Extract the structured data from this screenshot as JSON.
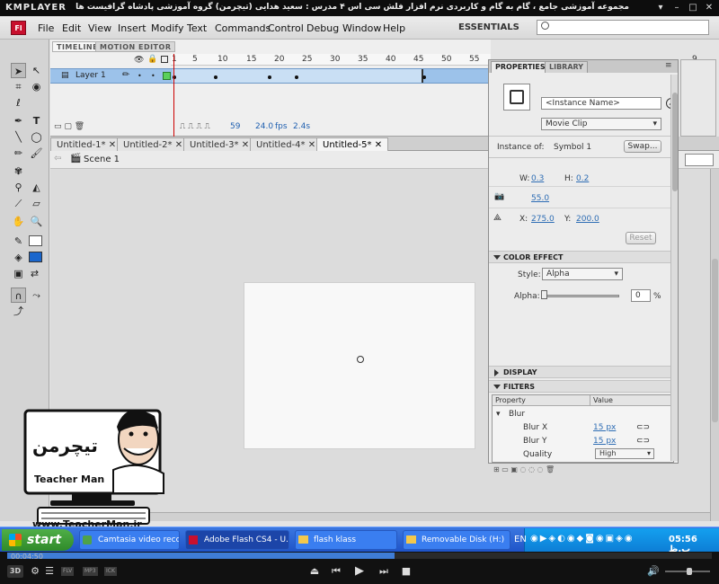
{
  "kmplayer": {
    "logo": "KMPLAYER",
    "title": "مجموعه آموزشی جامع ، گام به گام و کاربردی نرم افزار فلش سی اس ۴ مدرس : سعید هدایی (تیچرمن) گروه آموزشی پادشاه گرافیست ها",
    "time_display": "00:04:50",
    "progress": 0.55,
    "tags": [
      "FLV",
      "MP3",
      "ICK"
    ],
    "btn_3d": "3D"
  },
  "flash": {
    "logo": "Fl",
    "menu": [
      "File",
      "Edit",
      "View",
      "Insert",
      "Modify",
      "Text",
      "Commands",
      "Control",
      "Debug",
      "Window",
      "Help"
    ],
    "workspace": "ESSENTIALS",
    "search_placeholder": ""
  },
  "timeline": {
    "tabs": [
      "TIMELINE",
      "MOTION EDITOR"
    ],
    "frame_numbers": [
      "1",
      "5",
      "10",
      "15",
      "20",
      "25",
      "30",
      "35",
      "40",
      "45",
      "50",
      "55",
      "9"
    ],
    "layer_name": "Layer 1",
    "status": {
      "current_frame": "59",
      "fps": "24.0",
      "fps_unit": "fps",
      "time": "2.4s"
    }
  },
  "document_tabs": [
    "Untitled-1*",
    "Untitled-2*",
    "Untitled-3*",
    "Untitled-4*",
    "Untitled-5*"
  ],
  "scene": "Scene 1",
  "properties": {
    "tabs": [
      "PROPERTIES",
      "LIBRARY"
    ],
    "instance_name_placeholder": "<Instance Name>",
    "symbol_type": "Movie Clip",
    "instance_of_label": "Instance of:",
    "instance_of_value": "Symbol 1",
    "swap_label": "Swap...",
    "w_label": "W:",
    "w_value": "0.3",
    "h_label": "H:",
    "h_value": "0.2",
    "cam_value": "55.0",
    "x_label": "X:",
    "x_value": "275.0",
    "y_label": "Y:",
    "y_value": "200.0",
    "reset_label": "Reset",
    "color_effect_header": "COLOR EFFECT",
    "style_label": "Style:",
    "style_value": "Alpha",
    "alpha_label": "Alpha:",
    "alpha_value": "0",
    "alpha_unit": "%",
    "display_header": "DISPLAY",
    "filters_header": "FILTERS",
    "filters_col_property": "Property",
    "filters_col_value": "Value",
    "blur_label": "Blur",
    "blurx_label": "Blur X",
    "blurx_value": "15 px",
    "blury_label": "Blur Y",
    "blury_value": "15 px",
    "quality_label": "Quality",
    "quality_value": "High"
  },
  "taskbar": {
    "start": "start",
    "tasks": [
      "Camtasia video reco...",
      "Adobe Flash CS4 - U...",
      "flash klass",
      "Removable Disk (H:)"
    ],
    "lang": "EN",
    "clock": "05:56 ب.ظ"
  },
  "watermark": {
    "url": "www.TeacherMan.ir",
    "name_en": "Teacher Man",
    "name_fa": "تیچرمن"
  },
  "colors": {
    "tween": "#c9dff4",
    "layer_selected": "#9cc2ea",
    "taskbar": "#245edb",
    "start": "#3c9a38",
    "flash_red": "#c8102e"
  }
}
